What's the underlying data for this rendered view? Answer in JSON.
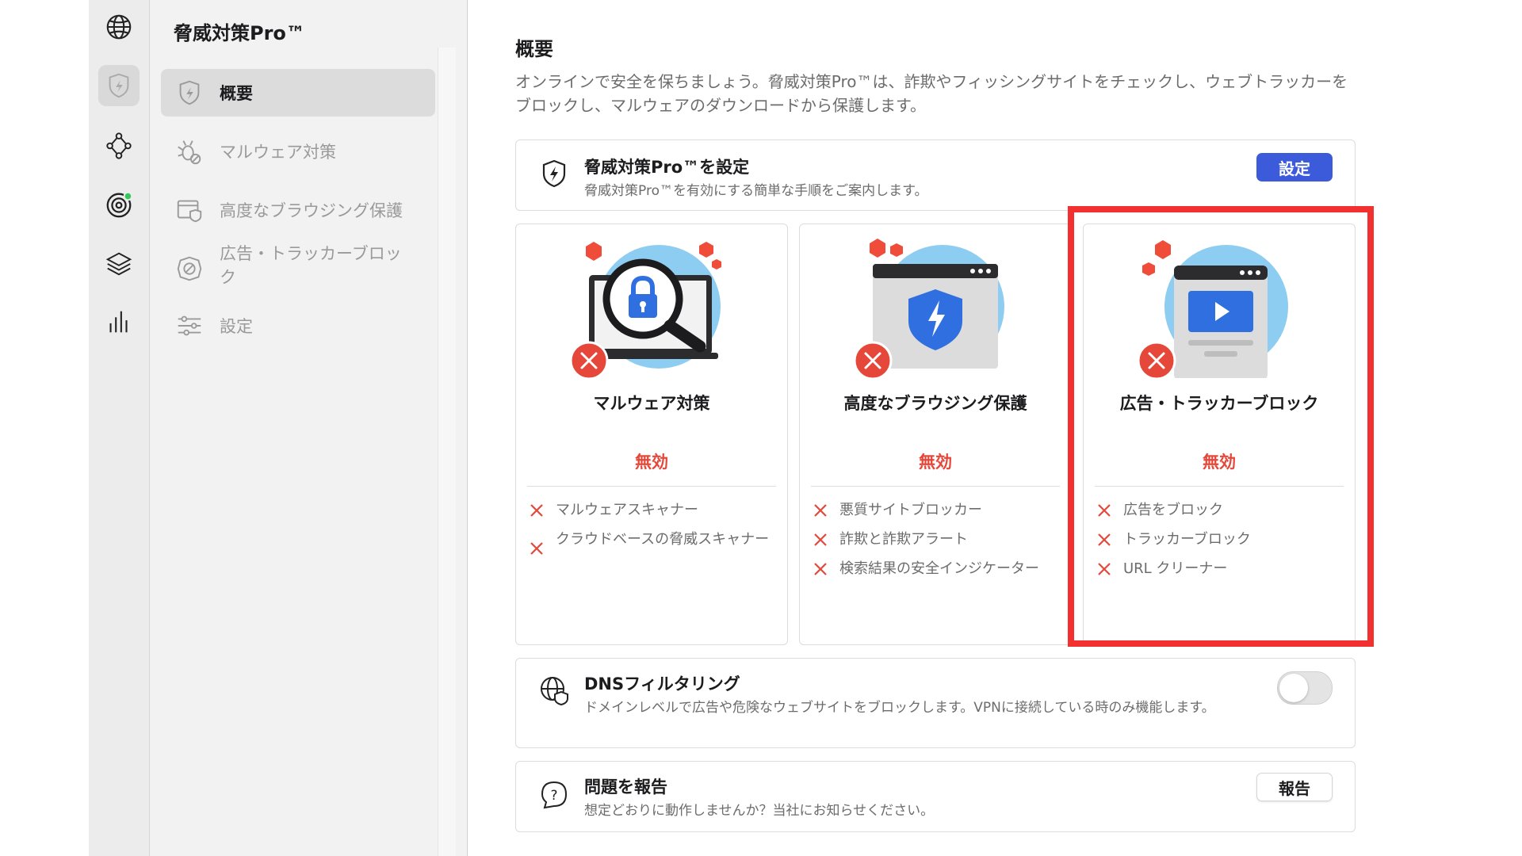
{
  "sidebar": {
    "title": "脅威対策Pro™",
    "items": [
      {
        "label": "概要",
        "icon": "shield-icon",
        "active": true
      },
      {
        "label": "マルウェア対策",
        "icon": "bug-icon"
      },
      {
        "label": "高度なブラウジング保護",
        "icon": "browser-shield-icon"
      },
      {
        "label": "広告・トラッカーブロック",
        "icon": "block-icon"
      },
      {
        "label": "設定",
        "icon": "sliders-icon"
      }
    ]
  },
  "rail": {
    "icons": [
      "globe-icon",
      "shield-icon",
      "network-icon",
      "radar-icon",
      "layers-icon",
      "stats-icon"
    ],
    "active": "shield-icon"
  },
  "main": {
    "title": "概要",
    "description": "オンラインで安全を保ちましょう。脅威対策Pro™は、詐欺やフィッシングサイトをチェックし、ウェブトラッカーをブロックし、マルウェアのダウンロードから保護します。",
    "setup": {
      "title": "脅威対策Pro™を設定",
      "subtitle": "脅威対策Pro™を有効にする簡単な手順をご案内します。",
      "button": "設定"
    },
    "features": [
      {
        "name": "マルウェア対策",
        "status": "無効",
        "items": [
          "マルウェアスキャナー",
          "クラウドベースの脅威スキャナー"
        ]
      },
      {
        "name": "高度なブラウジング保護",
        "status": "無効",
        "items": [
          "悪質サイトブロッカー",
          "詐欺と詐欺アラート",
          "検索結果の安全インジケーター"
        ]
      },
      {
        "name": "広告・トラッカーブロック",
        "status": "無効",
        "items": [
          "広告をブロック",
          "トラッカーブロック",
          "URL クリーナー"
        ]
      }
    ],
    "dns": {
      "title": "DNSフィルタリング",
      "subtitle": "ドメインレベルで広告や危険なウェブサイトをブロックします。VPNに接続している時のみ機能します。",
      "enabled": false
    },
    "report": {
      "title": "問題を報告",
      "subtitle": "想定どおりに動作しませんか？当社にお知らせください。",
      "button": "報告"
    }
  },
  "colors": {
    "accent": "#3b5bdb",
    "disabled": "#e5483a",
    "highlight": "#f23030"
  }
}
